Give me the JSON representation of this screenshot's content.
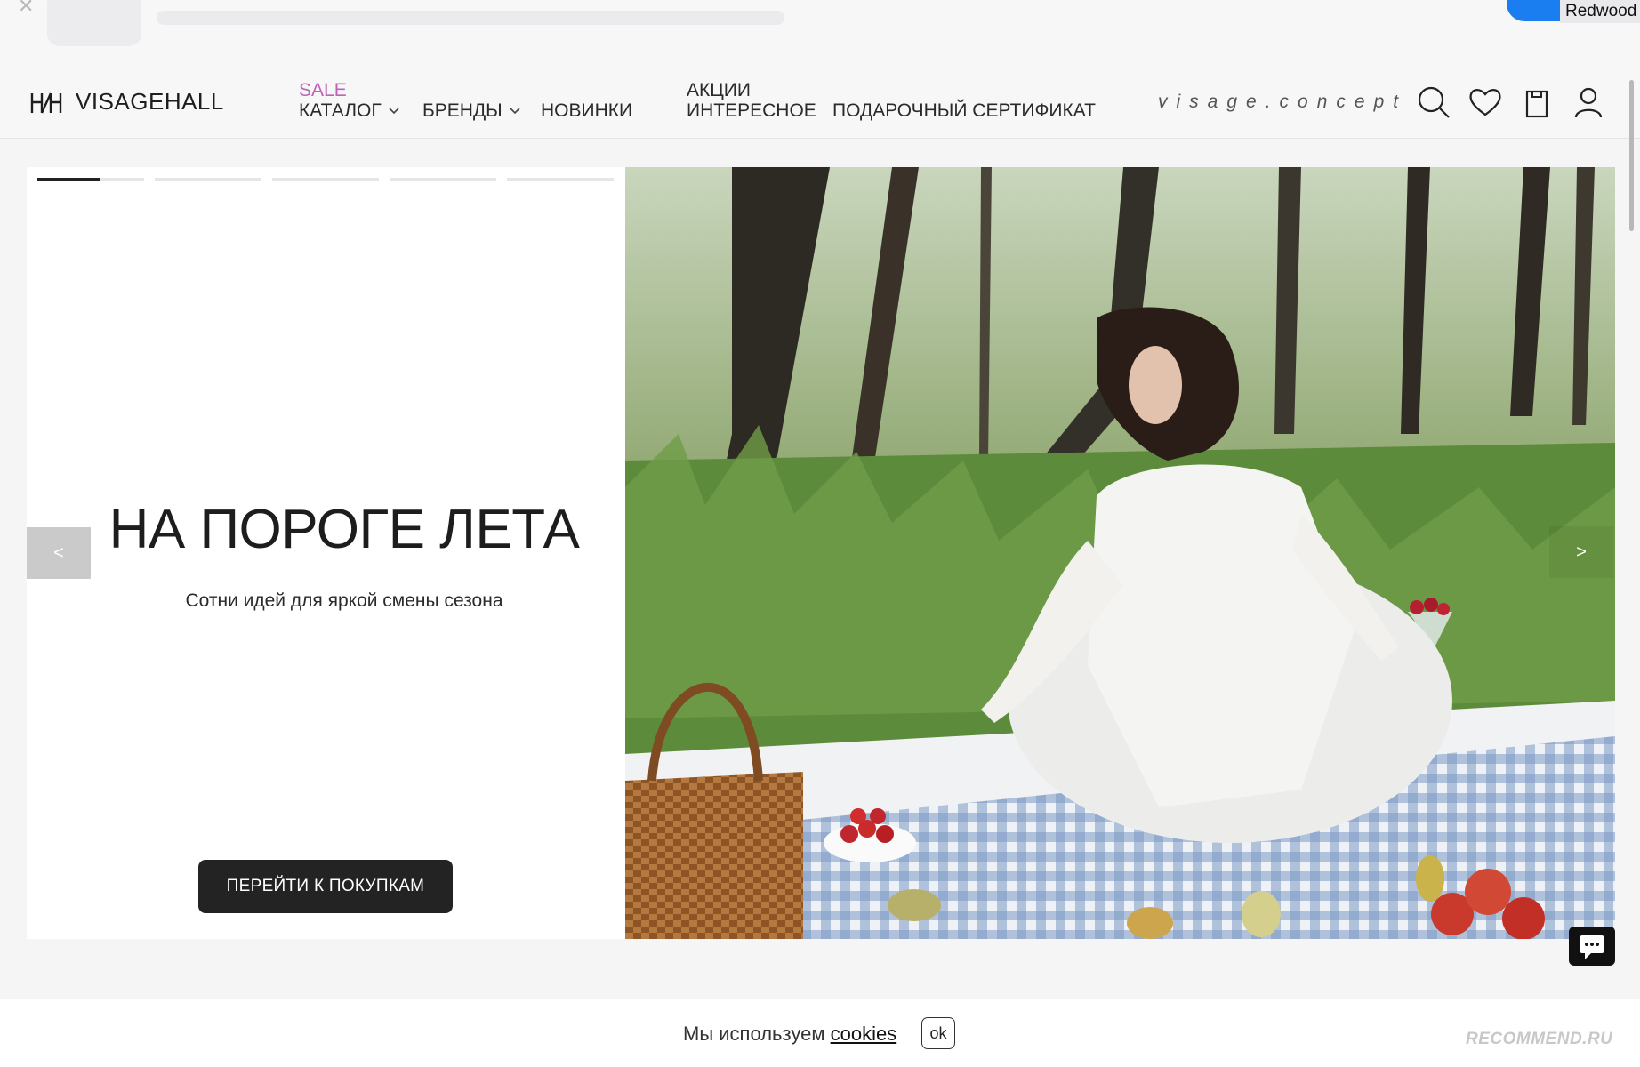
{
  "browser": {
    "badge": "Redwood"
  },
  "nav": {
    "brand": "VISAGEHALL",
    "sale": "SALE",
    "catalog": "КАТАЛОГ",
    "brands": "БРЕНДЫ",
    "news": "НОВИНКИ",
    "promos": "АКЦИИ",
    "interesting": "ИНТЕРЕСНОЕ",
    "gift_card": "ПОДАРОЧНЫЙ СЕРТИФИКАТ",
    "concept": "visage.concept",
    "icons": [
      "search-icon",
      "heart-icon",
      "cart-icon",
      "user-icon"
    ]
  },
  "hero": {
    "slide_count": 5,
    "active_slide": 1,
    "active_slide_progress": 0.6,
    "title": "НА ПОРОГЕ ЛЕТА",
    "subtitle": "Сотни идей для яркой смены сезона",
    "cta": "ПЕРЕЙТИ К ПОКУПКАМ",
    "prev": "<",
    "next": ">"
  },
  "cookie": {
    "text": "Мы используем",
    "link": "cookies",
    "ok": "ok"
  },
  "watermark": "RECOMMEND.RU",
  "colors": {
    "sale": "#c060b8",
    "cta": "#232323",
    "accent": "#1a7df0"
  }
}
